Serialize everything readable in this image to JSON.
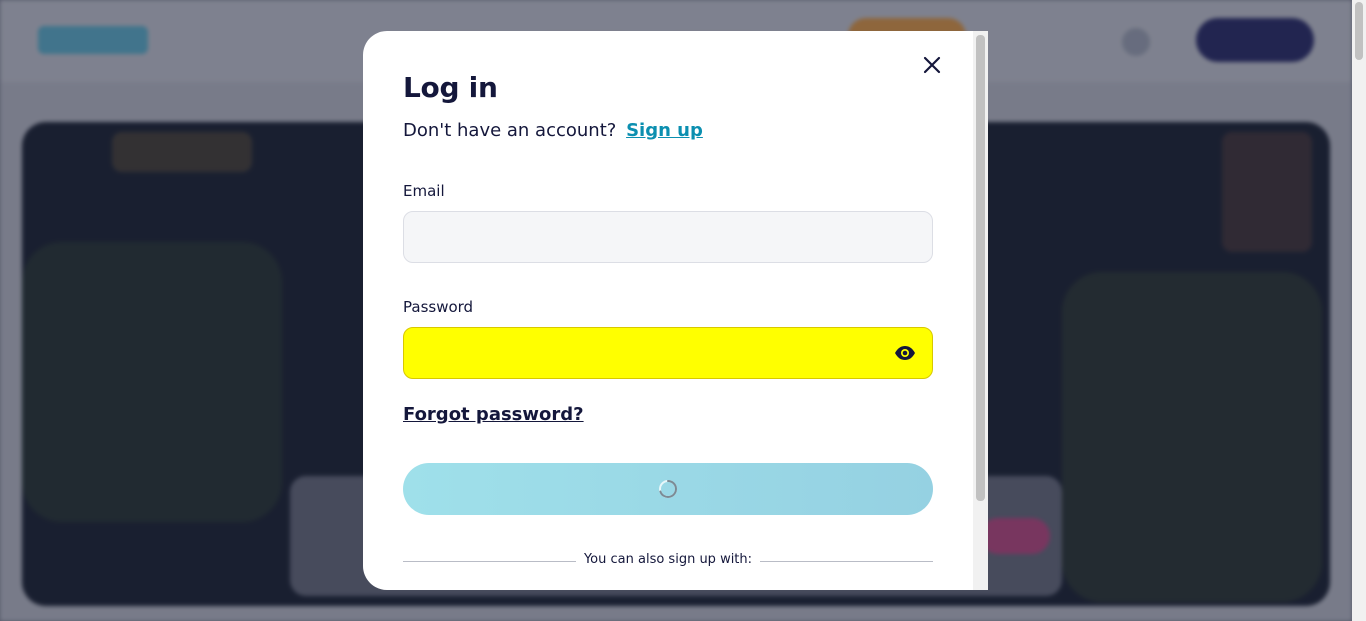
{
  "modal": {
    "title": "Log in",
    "signup_prompt": "Don't have an account?",
    "signup_link": "Sign up",
    "email_label": "Email",
    "email_value": "",
    "password_label": "Password",
    "password_value": "",
    "forgot_password": "Forgot password?",
    "submit_state": "loading",
    "alt_signup_text": "You can also sign up with:"
  },
  "icons": {
    "close": "close-icon",
    "password_toggle": "eye-icon",
    "submit_spinner": "spinner-icon"
  },
  "colors": {
    "title_text": "#14173b",
    "link": "#0b8fb0",
    "password_highlight": "#ffff00",
    "submit_button": "#9fe0ea"
  }
}
